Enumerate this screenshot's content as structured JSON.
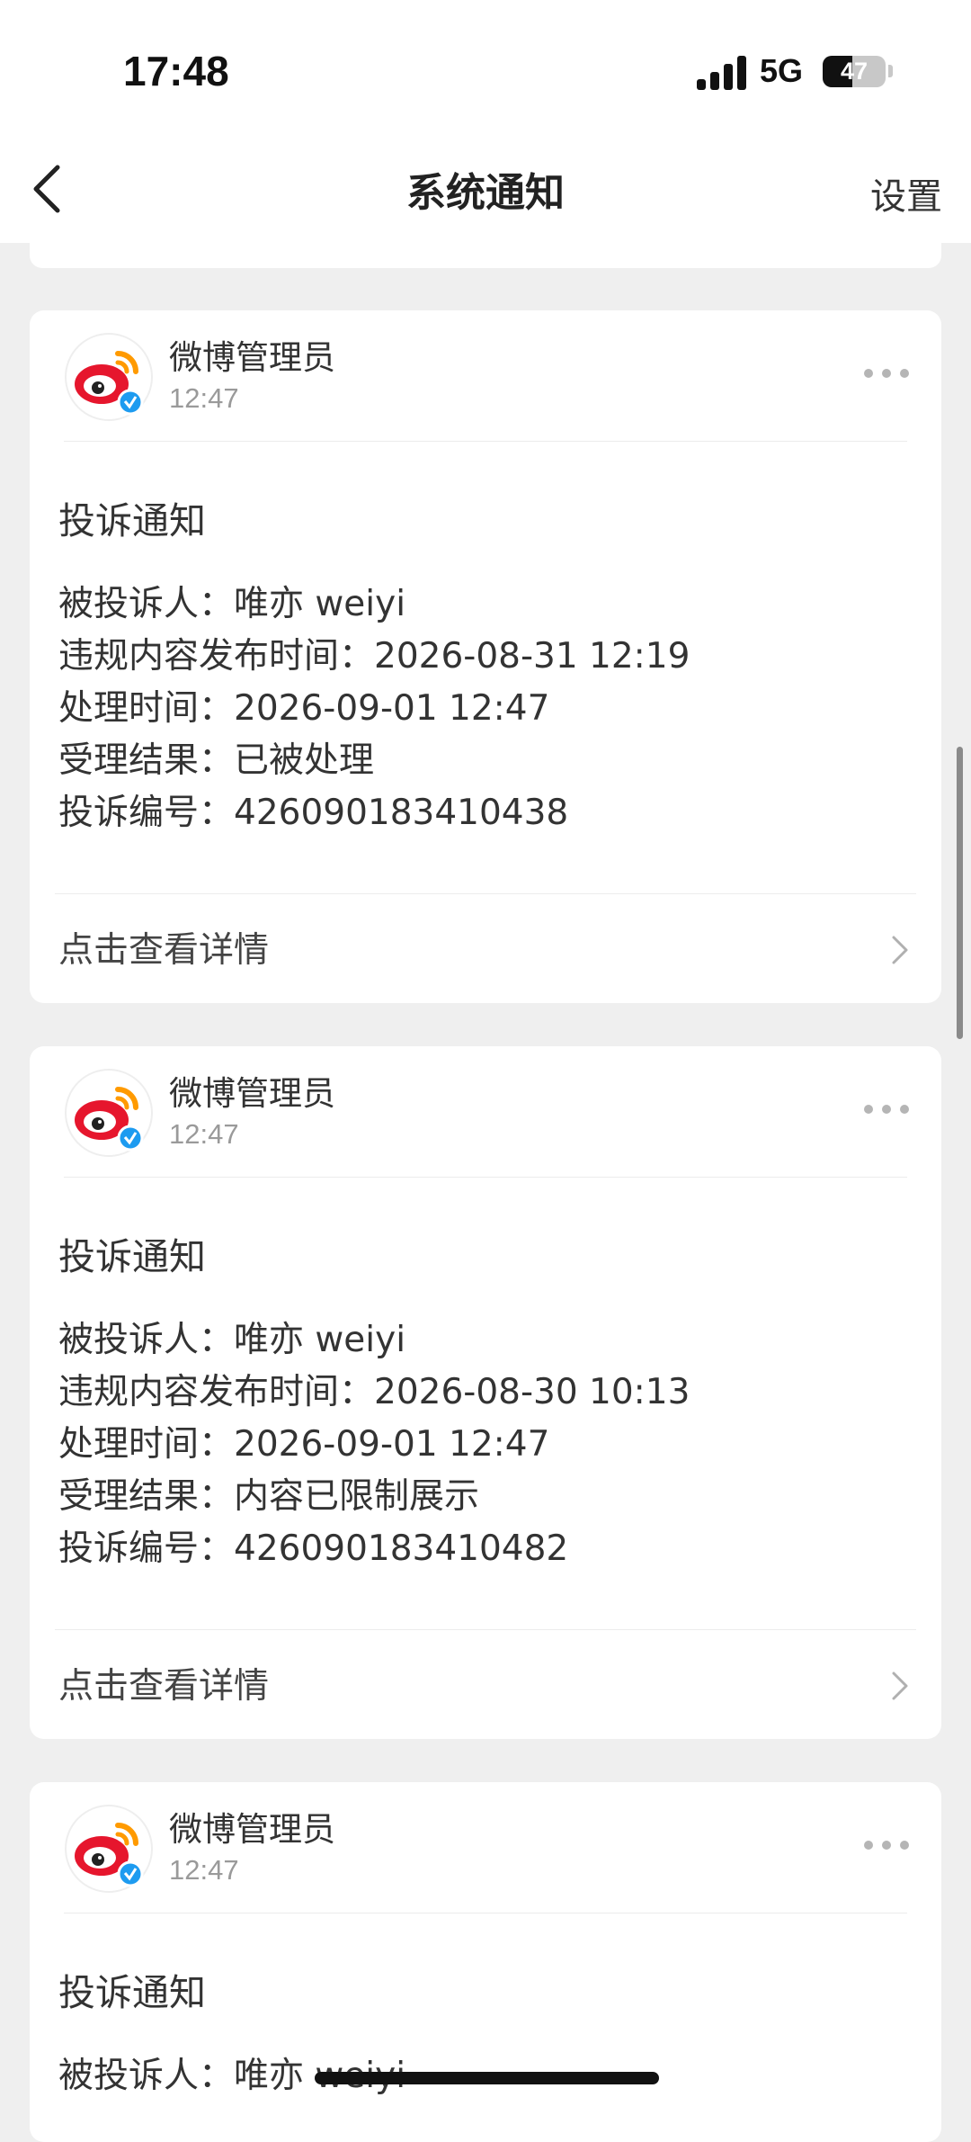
{
  "status_bar": {
    "time": "17:48",
    "network": "5G",
    "battery": "47",
    "battery_level": 0.47
  },
  "nav": {
    "title": "系统通知",
    "settings": "设置",
    "back_icon": "chevron-left-icon"
  },
  "cards": [
    {
      "sender": "微博管理员",
      "time": "12:47",
      "title": "投诉通知",
      "lines": [
        "被投诉人：唯亦 weiyi",
        "违规内容发布时间：2026-08-31 12:19",
        "处理时间：2026-09-01 12:47",
        "受理结果：已被处理",
        "投诉编号：426090183410438"
      ],
      "detail": "点击查看详情"
    },
    {
      "sender": "微博管理员",
      "time": "12:47",
      "title": "投诉通知",
      "lines": [
        "被投诉人：唯亦 weiyi",
        "违规内容发布时间：2026-08-30 10:13",
        "处理时间：2026-09-01 12:47",
        "受理结果：内容已限制展示",
        "投诉编号：426090183410482"
      ],
      "detail": "点击查看详情"
    },
    {
      "sender": "微博管理员",
      "time": "12:47",
      "title": "投诉通知",
      "lines": [
        "被投诉人：唯亦 weiyi"
      ],
      "detail": ""
    }
  ],
  "colors": {
    "brand_red": "#e6162d",
    "brand_orange": "#ff9a00",
    "verified_blue": "#1d9bf0"
  }
}
